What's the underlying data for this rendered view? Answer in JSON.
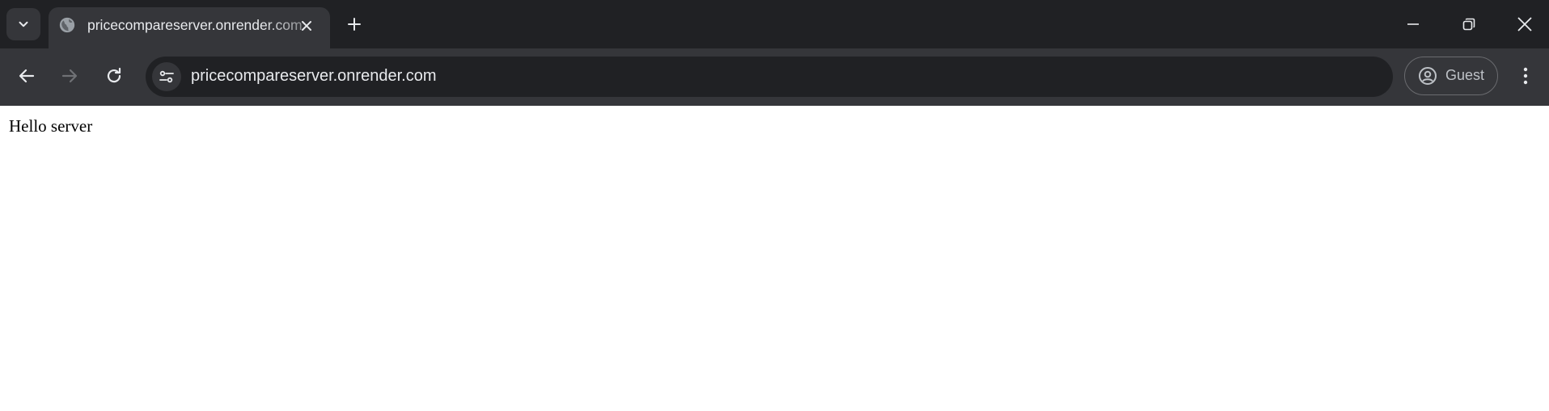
{
  "tab": {
    "title": "pricecompareserver.onrender.com",
    "favicon_icon": "globe-icon",
    "close_icon": "close-icon"
  },
  "tabstrip": {
    "tab_search_icon": "chevron-down-icon",
    "new_tab_icon": "plus-icon"
  },
  "window_controls": {
    "minimize_icon": "minimize-icon",
    "restore_icon": "restore-icon",
    "close_icon": "close-icon"
  },
  "toolbar": {
    "back_icon": "arrow-left-icon",
    "forward_icon": "arrow-right-icon",
    "reload_icon": "reload-icon",
    "site_info_icon": "tune-icon",
    "url": "pricecompareserver.onrender.com",
    "profile_label": "Guest",
    "profile_icon": "account-circle-icon",
    "menu_icon": "more-vert-icon"
  },
  "page": {
    "body_text": "Hello server"
  },
  "colors": {
    "tabstrip_bg": "#202124",
    "toolbar_bg": "#35363a",
    "omnibox_bg": "#202124",
    "text_light": "#e8eaed",
    "icon_disabled": "#6f7175"
  }
}
